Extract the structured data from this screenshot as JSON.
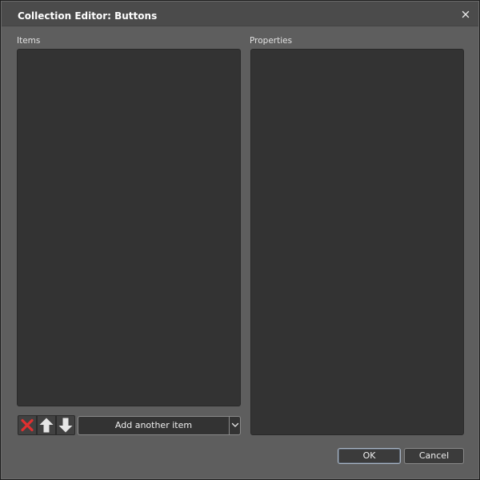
{
  "window": {
    "title": "Collection Editor: Buttons"
  },
  "items_section": {
    "label": "Items",
    "items": []
  },
  "properties_section": {
    "label": "Properties",
    "properties": []
  },
  "item_toolbar": {
    "delete_icon": "red-x-icon",
    "move_up_icon": "arrow-up-icon",
    "move_down_icon": "arrow-down-icon",
    "add_item_label": "Add another item",
    "dropdown_icon": "chevron-down-icon"
  },
  "footer": {
    "ok_label": "OK",
    "cancel_label": "Cancel"
  },
  "colors": {
    "dialog_background": "#5e5e5e",
    "panel_background": "#333333",
    "delete_icon": "#e03030",
    "text": "#ffffff"
  }
}
